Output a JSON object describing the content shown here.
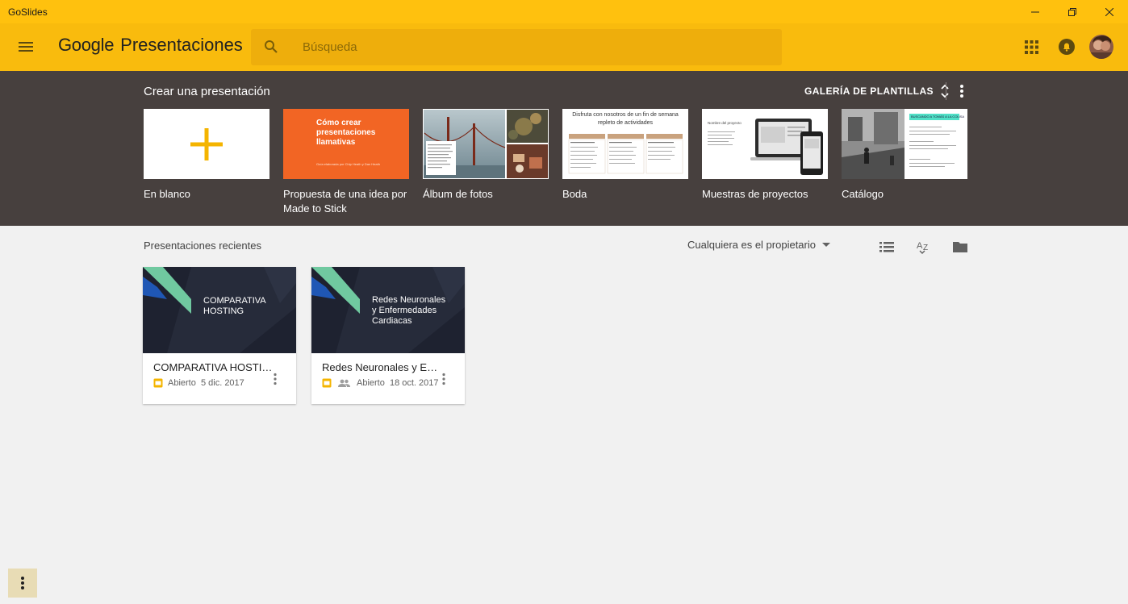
{
  "window": {
    "title": "GoSlides",
    "controls": [
      "minimize-icon",
      "restore-icon",
      "close-icon"
    ]
  },
  "header": {
    "brand_google": "Google",
    "brand_product": "Presentaciones",
    "search_placeholder": "Búsqueda",
    "icons": [
      "menu-icon",
      "search-icon",
      "apps-icon",
      "notifications-icon",
      "avatar"
    ]
  },
  "templates": {
    "title": "Crear una presentación",
    "gallery_label": "GALERÍA DE PLANTILLAS",
    "items": [
      {
        "name": "En blanco"
      },
      {
        "name": "Propuesta de una idea por Made to Stick",
        "thumb_title": "Cómo crear presentaciones llamativas",
        "thumb_sub": "Guía elaborada por Chip Heath y Dan Heath"
      },
      {
        "name": "Álbum de fotos"
      },
      {
        "name": "Boda",
        "thumb_title": "Disfruta con nosotros de un fin de semana repleto de actividades"
      },
      {
        "name": "Muestras de proyectos",
        "thumb_title": "Nombre del proyecto"
      },
      {
        "name": "Catálogo",
        "thumb_title": "BUSCANDO A TOMÁS A LA COLISA"
      }
    ]
  },
  "recent": {
    "title": "Presentaciones recientes",
    "owner_filter": "Cualquiera es el propietario",
    "tools": [
      "list-view-icon",
      "sort-az-icon",
      "folder-icon"
    ],
    "files": [
      {
        "thumb_text": [
          "COMPARATIVA",
          "HOSTING"
        ],
        "title": "COMPARATIVA HOSTING",
        "opened": "Abierto  5 dic. 2017",
        "shared": false
      },
      {
        "thumb_text": [
          "Redes Neuronales",
          "y Enfermedades",
          "Cardiacas"
        ],
        "title": "Redes Neuronales y Enfermedades Cardiacas",
        "opened": "Abierto  18 oct. 2017",
        "shared": true
      }
    ]
  },
  "colors": {
    "titlebar": "#ffc10e",
    "appbar": "#f9bb0d",
    "templates_band": "#47403e",
    "background": "#f1f1f1",
    "slides_yellow": "#f4b400"
  }
}
